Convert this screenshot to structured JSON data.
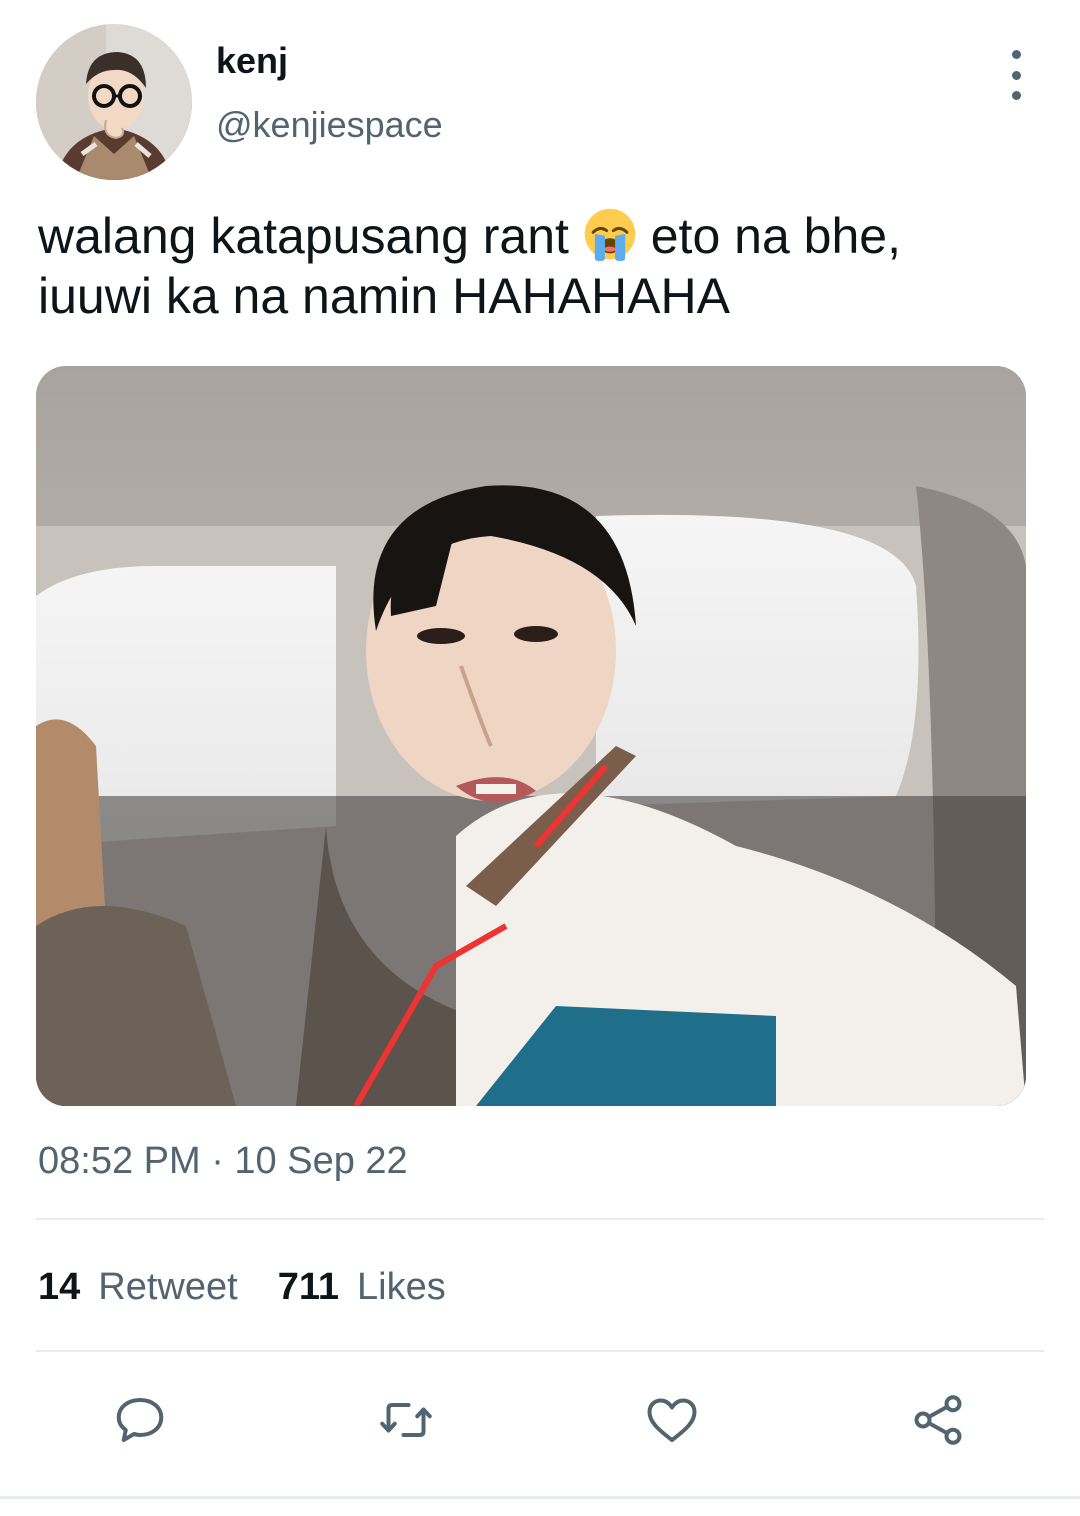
{
  "author": {
    "display_name": "kenj",
    "handle": "@kenjiespace"
  },
  "tweet": {
    "text_part1": "walang katapusang rant",
    "emoji": "loudly-crying-face-emoji",
    "text_part2": "eto na bhe,",
    "text_line2": "iuuwi ka na namin HAHAHAHA",
    "timestamp": "08:52 PM · 10 Sep 22"
  },
  "stats": {
    "retweet_count": "14",
    "retweet_label": "Retweet",
    "likes_count": "711",
    "likes_label": "Likes"
  },
  "actions": [
    {
      "icon": "reply-icon"
    },
    {
      "icon": "retweet-icon"
    },
    {
      "icon": "like-icon"
    },
    {
      "icon": "share-icon"
    }
  ],
  "colors": {
    "text_primary": "#0f1419",
    "text_secondary": "#536471",
    "divider": "#e6ecf0"
  }
}
